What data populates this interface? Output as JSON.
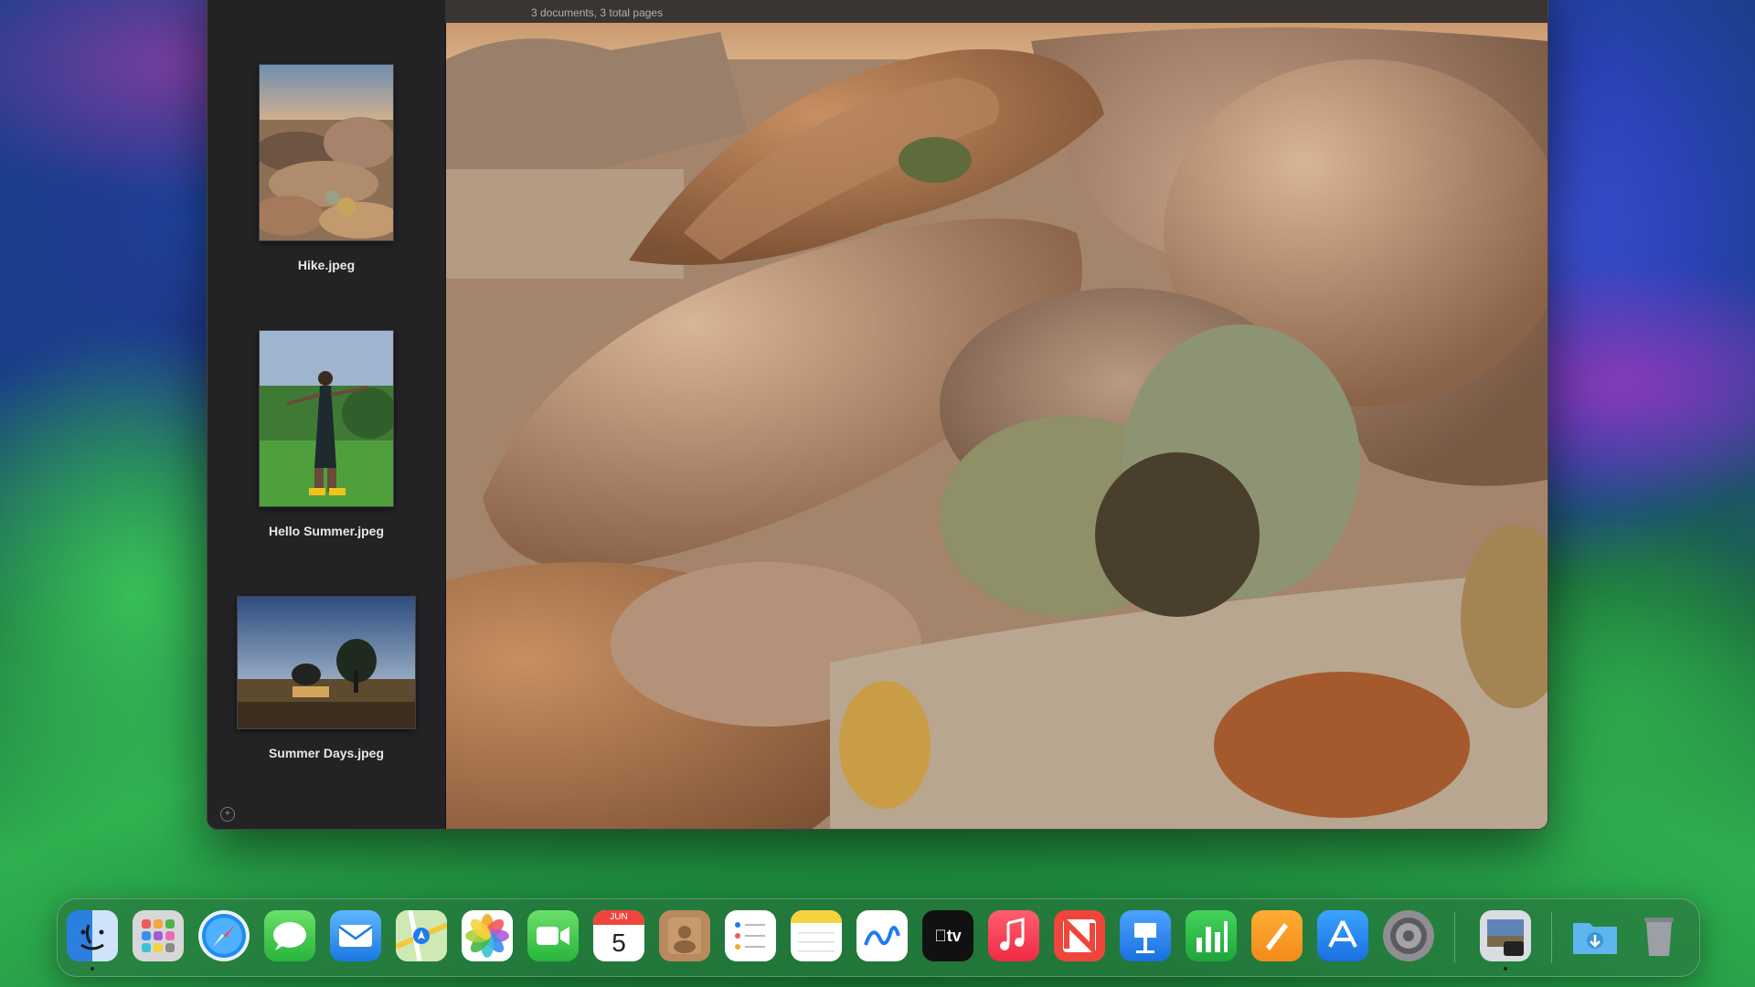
{
  "window": {
    "subtitle": "3 documents, 3 total pages",
    "sidebar": {
      "items": [
        {
          "label": "Hike.jpeg"
        },
        {
          "label": "Hello Summer.jpeg"
        },
        {
          "label": "Summer Days.jpeg"
        }
      ],
      "add_icon": "plus-circle-icon"
    }
  },
  "dock": {
    "calendar": {
      "month": "JUN",
      "day": "5"
    },
    "tv_label": "tv",
    "apps": [
      "Finder",
      "Launchpad",
      "Safari",
      "Messages",
      "Mail",
      "Maps",
      "Photos",
      "FaceTime",
      "Calendar",
      "Contacts",
      "Reminders",
      "Notes",
      "Freeform",
      "TV",
      "Music",
      "News",
      "Keynote",
      "Numbers",
      "Pages",
      "App Store",
      "System Settings",
      "Preview",
      "Downloads",
      "Trash"
    ]
  }
}
